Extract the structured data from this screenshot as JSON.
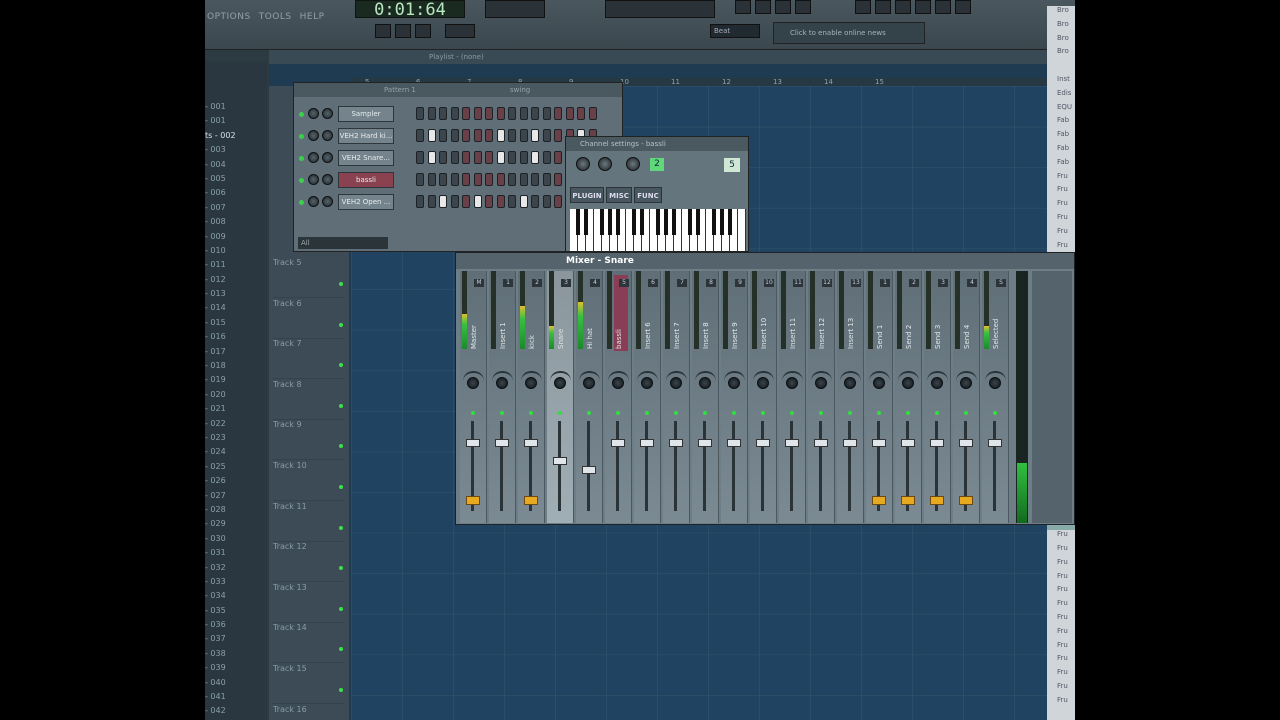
{
  "menu": [
    "OPTIONS",
    "TOOLS",
    "HELP"
  ],
  "time": "0:01:64",
  "beat_box": "Beat",
  "hint": "Click to enable online news",
  "playlist": {
    "title": "Playlist - (none)",
    "ruler": [
      "5",
      "6",
      "7",
      "8",
      "9",
      "10",
      "11",
      "12",
      "13",
      "14",
      "15"
    ],
    "tracks": [
      "Track 5",
      "Track 6",
      "Track 7",
      "Track 8",
      "Track 9",
      "Track 10",
      "Track 11",
      "Track 12",
      "Track 13",
      "Track 14",
      "Track 15",
      "Track 16"
    ]
  },
  "patterns": [
    "- 001",
    "- 001",
    "ts - 002",
    "- 003",
    "- 004",
    "- 005",
    "- 006",
    "- 007",
    "- 008",
    "- 009",
    "- 010",
    "- 011",
    "- 012",
    "- 013",
    "- 014",
    "- 015",
    "- 016",
    "- 017",
    "- 018",
    "- 019",
    "- 020",
    "- 021",
    "- 022",
    "- 023",
    "- 024",
    "- 025",
    "- 026",
    "- 027",
    "- 028",
    "- 029",
    "- 030",
    "- 031",
    "- 032",
    "- 033",
    "- 034",
    "- 035",
    "- 036",
    "- 037",
    "- 038",
    "- 039",
    "- 040",
    "- 041",
    "- 042"
  ],
  "stepseq": {
    "title": "Pattern 1",
    "swing": "swing",
    "filter": "All",
    "channels": [
      {
        "name": "Sampler",
        "steps": "0000000000000000"
      },
      {
        "name": "VEH2 Hard ki...",
        "steps": "0000000000000000"
      },
      {
        "name": "VEH2 Snare...",
        "steps": "0000000000000000"
      },
      {
        "name": "bassli",
        "steps": "0000000000000000"
      },
      {
        "name": "VEH2 Open ...",
        "steps": "0000000000000000"
      }
    ]
  },
  "channel_settings": {
    "title": "Channel settings - bassli",
    "knobs": [
      "PAN",
      "VOL",
      "PITCH"
    ],
    "value": "2",
    "fx": "5",
    "tabs": [
      "PLUGIN",
      "MISC",
      "FUNC"
    ]
  },
  "mixer": {
    "title": "Mixer - Snare",
    "strips": [
      {
        "name": "Master",
        "num": "M",
        "level": 0.45
      },
      {
        "name": "Insert 1",
        "num": "1",
        "level": 0
      },
      {
        "name": "kick",
        "num": "2",
        "level": 0.55
      },
      {
        "name": "Snare",
        "num": "3",
        "level": 0.3
      },
      {
        "name": "Hi hat",
        "num": "4",
        "level": 0.6
      },
      {
        "name": "bassli",
        "num": "5",
        "level": 0
      },
      {
        "name": "Insert 6",
        "num": "6",
        "level": 0
      },
      {
        "name": "Insert 7",
        "num": "7",
        "level": 0
      },
      {
        "name": "Insert 8",
        "num": "8",
        "level": 0
      },
      {
        "name": "Insert 9",
        "num": "9",
        "level": 0
      },
      {
        "name": "Insert 10",
        "num": "10",
        "level": 0
      },
      {
        "name": "Insert 11",
        "num": "11",
        "level": 0
      },
      {
        "name": "Insert 12",
        "num": "12",
        "level": 0
      },
      {
        "name": "Insert 13",
        "num": "13",
        "level": 0
      },
      {
        "name": "Send 1",
        "num": "1",
        "level": 0
      },
      {
        "name": "Send 2",
        "num": "2",
        "level": 0
      },
      {
        "name": "Send 3",
        "num": "3",
        "level": 0
      },
      {
        "name": "Send 4",
        "num": "4",
        "level": 0
      },
      {
        "name": "Selected",
        "num": "S",
        "level": 0.3
      }
    ]
  },
  "right_list": [
    "Bro",
    "Bro",
    "Bro",
    "Bro",
    "",
    "Inst",
    "Edis",
    "EQU",
    "Fab",
    "Fab",
    "Fab",
    "Fab",
    "Fru",
    "Fru",
    "Fru",
    "Fru",
    "Fru",
    "Fru",
    "Fru",
    "Fru",
    "Fru",
    "Fru",
    "Fru",
    "Fru",
    "Fru",
    "Fru",
    "Fru",
    "Fru",
    "Fru",
    "Fru",
    "Fru",
    "Fru",
    "Fru",
    "Fru",
    "Fru",
    "Fru",
    "Fru",
    "Fru",
    "Fru",
    "Fru",
    "Fru",
    "Fru",
    "Fru",
    "Fru",
    "Fru",
    "Fru",
    "Fru",
    "Fru",
    "Fru",
    "Fru",
    "Fru"
  ]
}
